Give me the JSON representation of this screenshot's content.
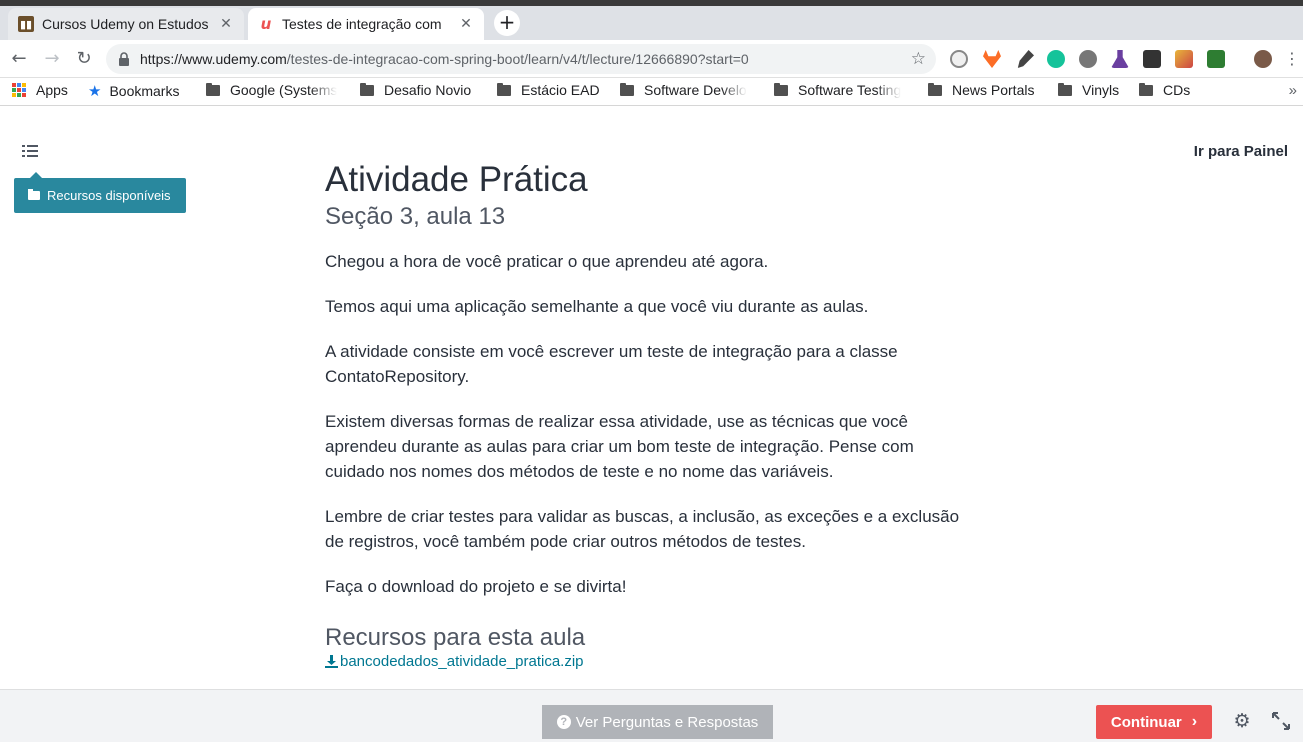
{
  "browser": {
    "tabs": [
      {
        "title": "Cursos Udemy on Estudos",
        "active": false
      },
      {
        "title": "Testes de integração com",
        "active": true
      }
    ],
    "new_tab": "+",
    "url_host": "https://www.udemy.com",
    "url_path": "/testes-de-integracao-com-spring-boot/learn/v4/t/lecture/12666890?start=0",
    "bookmarks": [
      {
        "label": "Apps",
        "icon": "apps-grid-icon"
      },
      {
        "label": "Bookmarks",
        "icon": "star-icon"
      },
      {
        "label": "Google (Systems",
        "icon": "folder-icon"
      },
      {
        "label": "Desafio Novio",
        "icon": "folder-icon"
      },
      {
        "label": "Estácio EAD",
        "icon": "folder-icon"
      },
      {
        "label": "Software Develo",
        "icon": "folder-icon"
      },
      {
        "label": "Software Testing",
        "icon": "folder-icon"
      },
      {
        "label": "News Portals",
        "icon": "folder-icon"
      },
      {
        "label": "Vinyls",
        "icon": "folder-icon"
      },
      {
        "label": "CDs",
        "icon": "folder-icon"
      }
    ],
    "more": "»"
  },
  "page": {
    "resources_button": "Recursos disponíveis",
    "goto_panel": "Ir para Painel",
    "title": "Atividade Prática",
    "subtitle": "Seção 3, aula 13",
    "paragraphs": [
      "Chegou a hora de você praticar o que aprendeu até agora.",
      "Temos aqui uma aplicação semelhante a que você viu durante as aulas.",
      "A atividade consiste em você escrever um teste de integração para a classe ContatoRepository.",
      "Existem diversas formas de realizar essa atividade, use as técnicas que você aprendeu durante as aulas para criar um bom teste de integração. Pense com cuidado nos nomes dos métodos de teste e no nome das variáveis.",
      "Lembre de criar testes para validar as buscas, a inclusão, as exceções e a exclusão de registros, você também pode criar outros métodos de testes.",
      "Faça o download do projeto e se divirta!"
    ],
    "resources_heading": "Recursos para esta aula",
    "resource_file": "bancodedados_atividade_pratica.zip"
  },
  "footer": {
    "qa_button": "Ver Perguntas e Respostas",
    "continue_button": "Continuar"
  },
  "colors": {
    "teal": "#29889e",
    "continue_red": "#ec5252",
    "link": "#007791"
  }
}
